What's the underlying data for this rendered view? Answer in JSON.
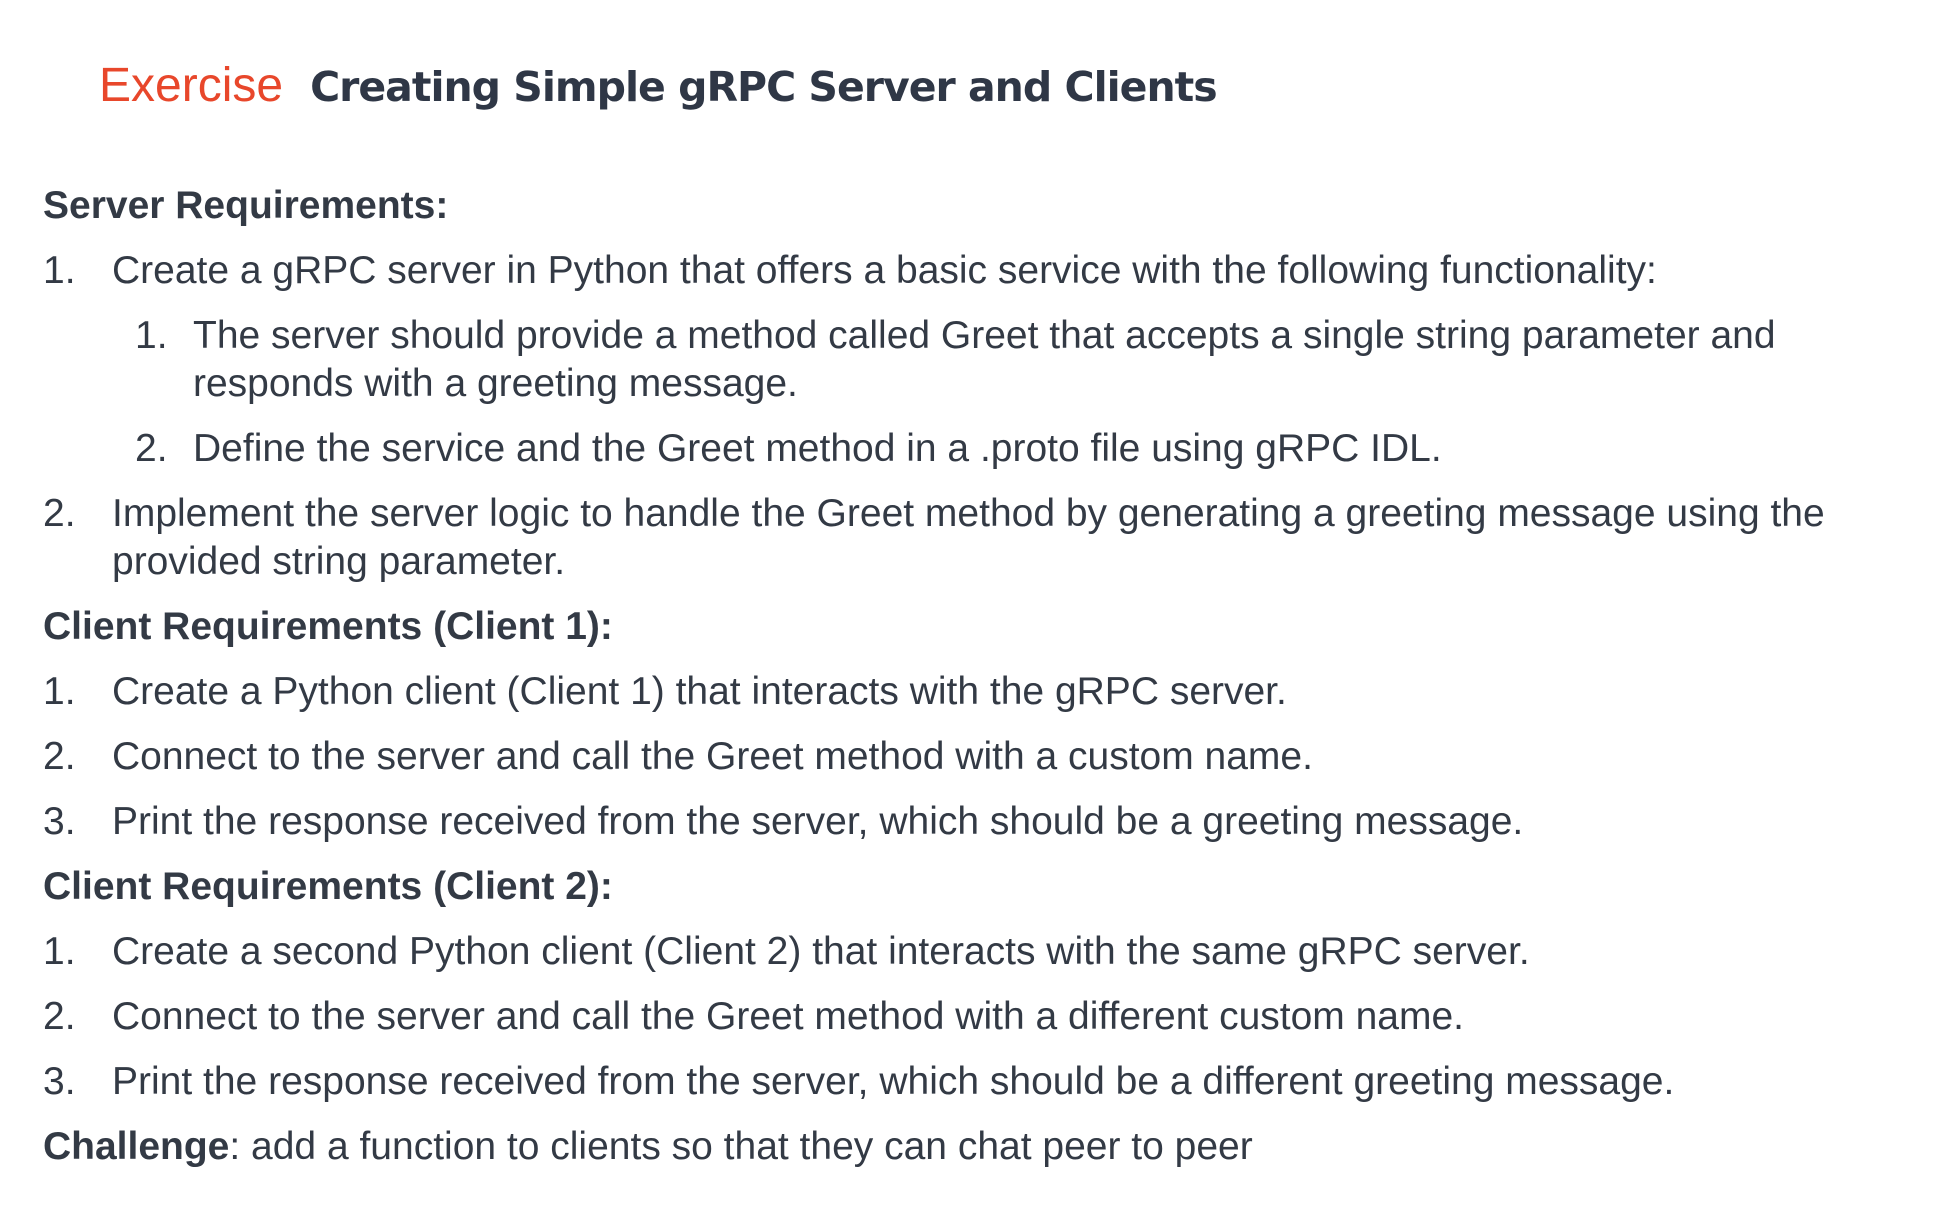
{
  "title": {
    "tag": "Exercise",
    "main": "Creating Simple gRPC Server and Clients"
  },
  "server": {
    "heading": "Server Requirements:",
    "item1": {
      "num": "1.",
      "text": "Create a gRPC server in Python that offers a basic service with the following functionality:",
      "sub": [
        {
          "num": "1.",
          "text": "The server should provide a method called Greet that accepts a single string parameter and responds with a greeting message."
        },
        {
          "num": "2.",
          "text": "Define the service and the Greet method in a .proto file using gRPC IDL."
        }
      ]
    },
    "item2": {
      "num": "2.",
      "text": "Implement the server logic to handle the Greet method by generating a greeting message using the provided string parameter."
    }
  },
  "client1": {
    "heading": "Client Requirements (Client 1):",
    "items": [
      {
        "num": "1.",
        "text": "Create a Python client (Client 1) that interacts with the gRPC server."
      },
      {
        "num": "2.",
        "text": "Connect to the server and call the Greet method with a custom name."
      },
      {
        "num": "3.",
        "text": "Print the response received from the server, which should be a greeting message."
      }
    ]
  },
  "client2": {
    "heading": "Client Requirements (Client 2):",
    "items": [
      {
        "num": "1.",
        "text": "Create a second Python client (Client 2) that interacts with the same gRPC server."
      },
      {
        "num": "2.",
        "text": "Connect to the server and call the Greet method with a different custom name."
      },
      {
        "num": "3.",
        "text": "Print the response received from the server, which should be a different greeting message."
      }
    ]
  },
  "challenge": {
    "label": "Challenge",
    "text": ": add a function to clients so that they can chat peer to peer"
  },
  "colors": {
    "accent": "#e8472b",
    "title": "#2f3746",
    "body": "#333a45"
  }
}
